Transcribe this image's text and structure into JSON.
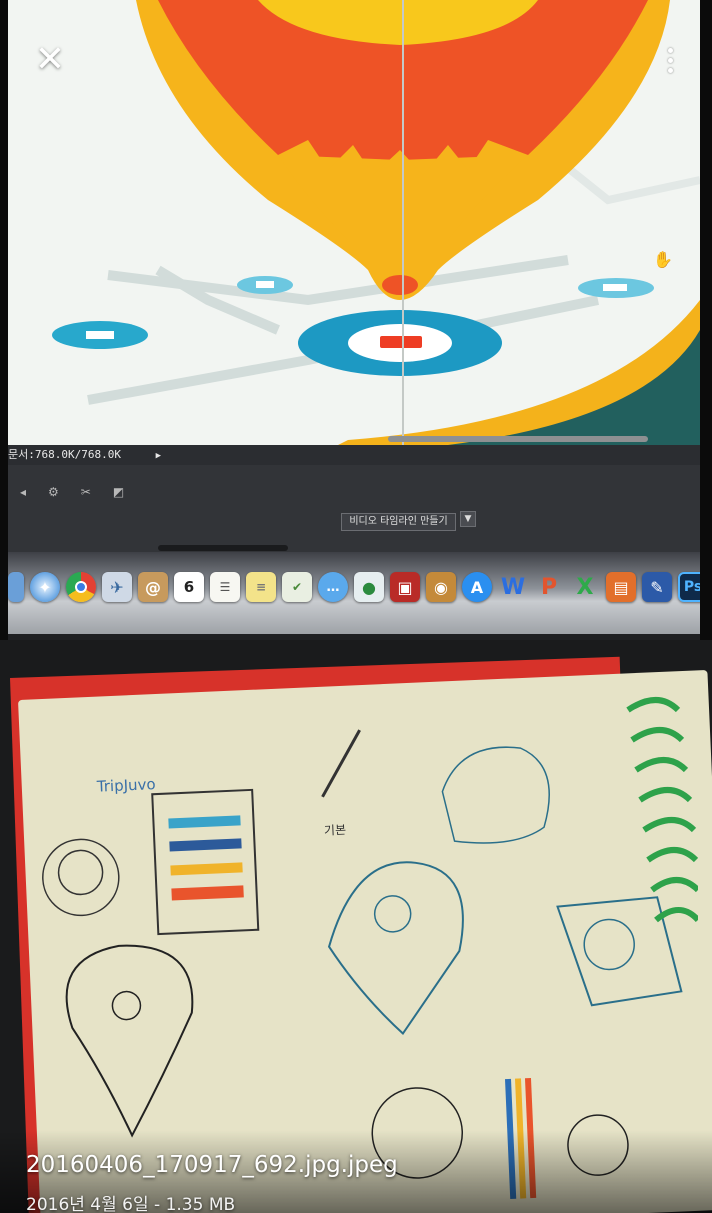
{
  "viewer": {
    "close_icon": "close-icon",
    "more_icon": "more-vert-icon"
  },
  "photo": {
    "ps_status_text": "문서:768.0K/768.0K",
    "timeline_button_label": "비디오 타임라인 만들기",
    "dock_icons": [
      "finder",
      "safari",
      "chrome",
      "preview",
      "contacts",
      "calendar",
      "reminders",
      "notes",
      "tasks",
      "messages",
      "facetime",
      "photo-booth",
      "iphoto",
      "app-store",
      "word",
      "powerpoint",
      "excel",
      "keynote",
      "pen",
      "photoshop"
    ],
    "calendar_day": "6",
    "sketch_title_text": "TripJuvo",
    "sketch_label_text": "기본"
  },
  "file": {
    "name": "20160406_170917_692.jpg.jpeg",
    "meta": "2016년 4월 6일 - 1.35 MB"
  }
}
